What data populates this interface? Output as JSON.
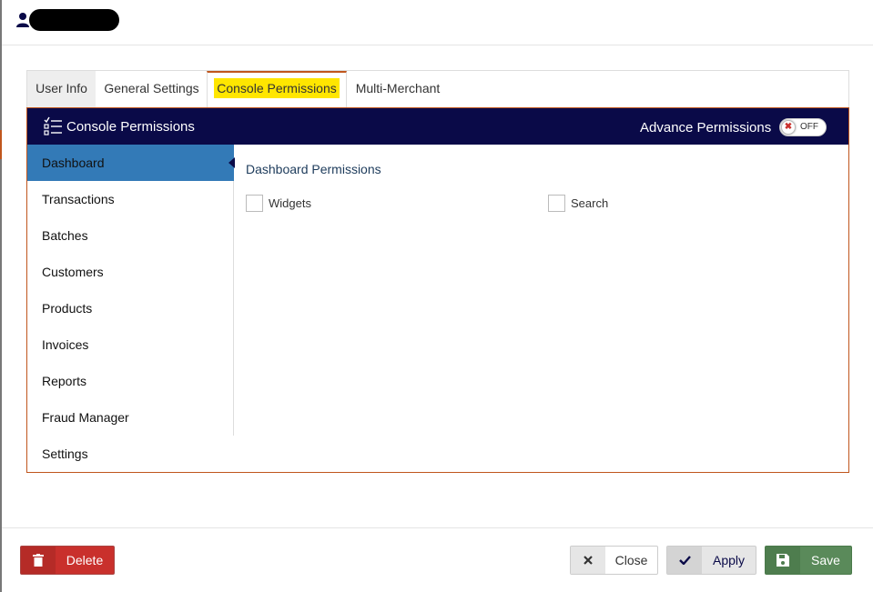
{
  "header": {
    "user_icon": "user-icon"
  },
  "tabs": [
    {
      "label": "User Info"
    },
    {
      "label": "General Settings"
    },
    {
      "label": "Console Permissions",
      "active": true
    },
    {
      "label": "Multi-Merchant"
    }
  ],
  "panel": {
    "title": "Console Permissions",
    "title_icon": "checklist-icon",
    "advance_label": "Advance Permissions",
    "toggle_text": "OFF",
    "toggle_state": "off"
  },
  "nav": [
    {
      "label": "Dashboard",
      "active": true
    },
    {
      "label": "Transactions"
    },
    {
      "label": "Batches"
    },
    {
      "label": "Customers"
    },
    {
      "label": "Products"
    },
    {
      "label": "Invoices"
    },
    {
      "label": "Reports"
    },
    {
      "label": "Fraud Manager"
    },
    {
      "label": "Settings"
    }
  ],
  "content": {
    "title": "Dashboard Permissions",
    "permissions": [
      {
        "label": "Widgets",
        "checked": false
      },
      {
        "label": "Search",
        "checked": false
      }
    ]
  },
  "footer": {
    "delete_label": "Delete",
    "close_label": "Close",
    "apply_label": "Apply",
    "save_label": "Save"
  },
  "colors": {
    "accent": "#c0561d",
    "panel_header": "#0a0a48",
    "active_nav": "#337ab7",
    "highlight": "#ffe600",
    "delete": "#c9302c",
    "save": "#5a8a5a"
  }
}
